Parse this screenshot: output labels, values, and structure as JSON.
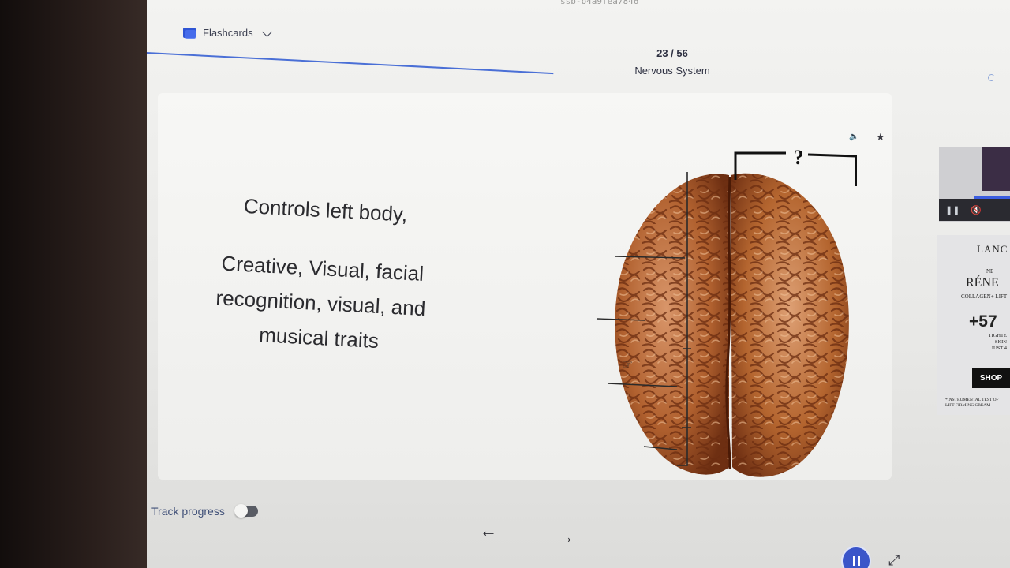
{
  "browser": {
    "url_fragment": "ssb-b4a9fea7846"
  },
  "header": {
    "mode_label": "Flashcards",
    "counter": "23 / 56",
    "deck_title": "Nervous System"
  },
  "card": {
    "definition_line_1": "Controls left body,",
    "definition_line_2": "Creative, Visual, facial recognition, visual, and musical traits",
    "image_question_mark": "?",
    "icons": [
      "audio-icon",
      "star-icon"
    ]
  },
  "footer": {
    "track_progress_label": "Track progress",
    "track_progress_enabled": false,
    "prev_icon": "arrow-left",
    "next_icon": "arrow-right"
  },
  "ad": {
    "brand": "LANC",
    "new_label": "NE",
    "product": "RÉNE",
    "subline": "COLLAGEN+ LIFT",
    "stat": "+57",
    "claim": "TIGHTE SKIN JUST 4",
    "cta": "SHOP",
    "fine_print": "*INSTRUMENTAL TEST OF LIFT-FIRMING CREAM"
  },
  "colors": {
    "accent": "#3a55c9",
    "progress": "#4a6fd6",
    "text": "#2b2b2f",
    "brain": "#a8532a"
  }
}
